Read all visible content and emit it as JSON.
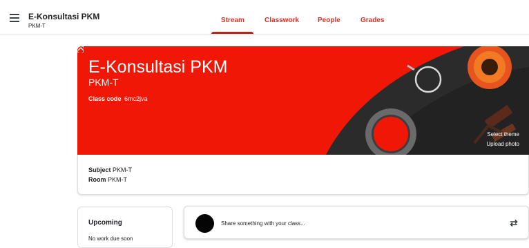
{
  "header": {
    "class_name": "E-Konsultasi PKM",
    "section": "PKM-T",
    "tabs": [
      {
        "label": "Stream",
        "active": true
      },
      {
        "label": "Classwork"
      },
      {
        "label": "People"
      },
      {
        "label": "Grades"
      }
    ],
    "accent_color": "#d93025"
  },
  "banner": {
    "title": "E-Konsultasi PKM",
    "subtitle": "PKM-T",
    "class_code_label": "Class code",
    "class_code": "6mc2jva",
    "select_theme": "Select theme",
    "upload_photo": "Upload photo",
    "color": "#f01707"
  },
  "details": {
    "subject_label": "Subject",
    "subject_value": "PKM-T",
    "room_label": "Room",
    "room_value": "PKM-T"
  },
  "upcoming": {
    "title": "Upcoming",
    "empty_text": "No work due soon"
  },
  "stream": {
    "share_placeholder": "Share something with your class..."
  },
  "icons": [
    "menu-icon",
    "fullscreen-icon",
    "chevron-up-icon",
    "repost-icon"
  ]
}
